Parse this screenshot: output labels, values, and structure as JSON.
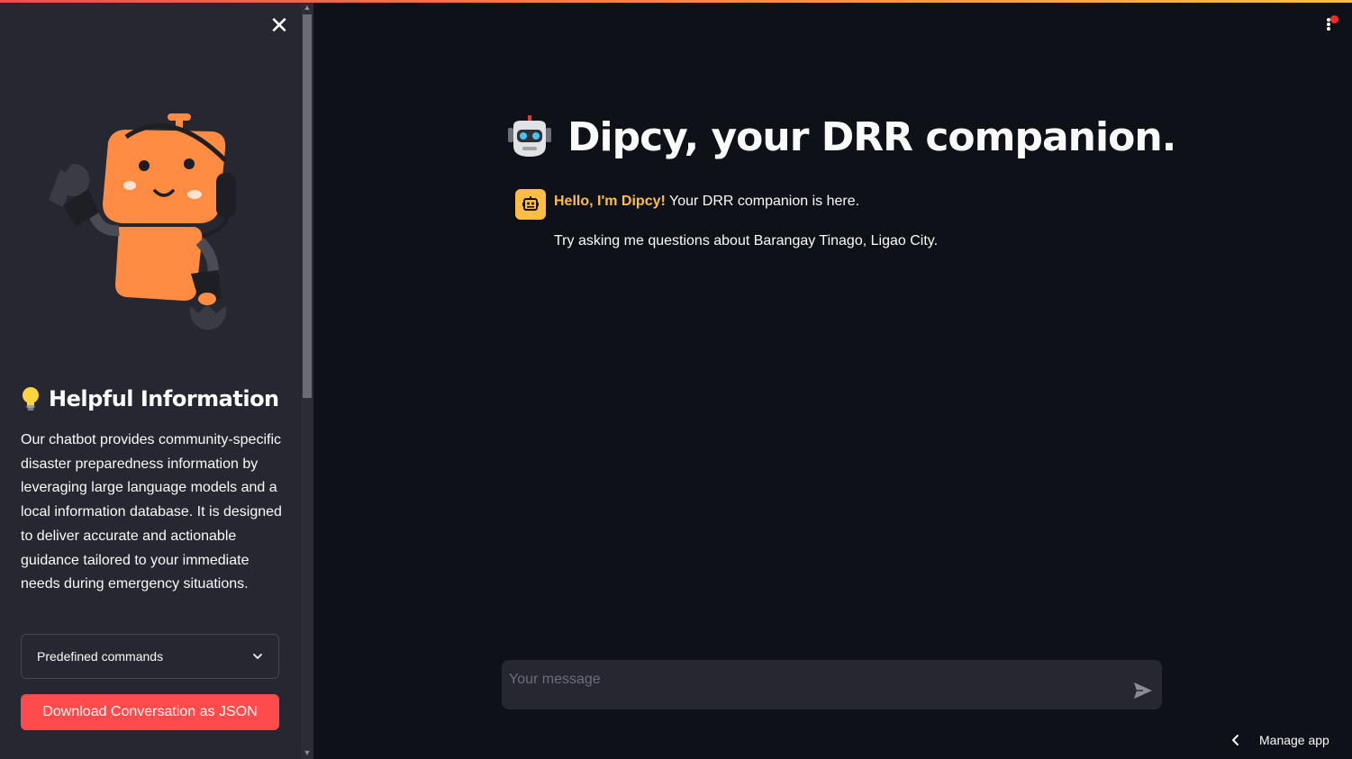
{
  "sidebar": {
    "close_icon": "close-icon",
    "robot_image": "robot-mascot-waving",
    "info_icon": "lightbulb-icon",
    "heading": "Helpful Information",
    "description": "Our chatbot provides community-specific disaster preparedness information by leveraging large language models and a local information database. It is designed to deliver accurate and actionable guidance tailored to your immediate needs during emergency situations.",
    "predefined_select": {
      "label": "Predefined commands",
      "icon": "chevron-down-icon"
    },
    "download_button": "Download Conversation as JSON"
  },
  "header": {
    "menu_icon": "kebab-menu-icon"
  },
  "main": {
    "title_icon": "robot-face-icon",
    "title": "Dipcy, your DRR companion.",
    "messages": [
      {
        "avatar_icon": "bot-avatar-icon",
        "greeting": "Hello, I'm Dipcy!",
        "line1_rest": " Your DRR companion is here.",
        "line2": "Try asking me questions about Barangay Tinago, Ligao City."
      }
    ]
  },
  "chat_input": {
    "placeholder": "Your message",
    "value": "",
    "send_icon": "send-icon"
  },
  "footer": {
    "manage_app": "Manage app",
    "manage_icon": "chevron-left-icon"
  },
  "colors": {
    "background": "#0e1117",
    "sidebar": "#262730",
    "accent_red": "#ff4b4b",
    "accent_yellow": "#ffbd45",
    "text": "#fafafa"
  }
}
